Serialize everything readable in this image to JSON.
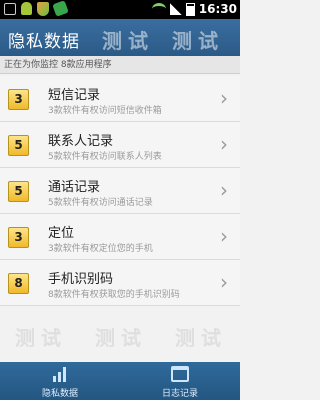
{
  "status_bar": {
    "time": "16:30",
    "icons": [
      "usb-icon",
      "android-icon",
      "shield-icon",
      "phone-icon",
      "wifi-icon",
      "signal-icon",
      "battery-icon"
    ]
  },
  "header": {
    "title": "隐私数据",
    "watermark": "测试"
  },
  "subheader": {
    "text": "正在为你监控 8款应用程序"
  },
  "list": [
    {
      "count": "3",
      "title": "短信记录",
      "subtitle": "3款软件有权访问短信收件箱"
    },
    {
      "count": "5",
      "title": "联系人记录",
      "subtitle": "5款软件有权访问联系人列表"
    },
    {
      "count": "5",
      "title": "通话记录",
      "subtitle": "5款软件有权访问通话记录"
    },
    {
      "count": "3",
      "title": "定位",
      "subtitle": "3款软件有权定位您的手机"
    },
    {
      "count": "8",
      "title": "手机识别码",
      "subtitle": "8款软件有权获取您的手机识别码"
    }
  ],
  "tabs": [
    {
      "label": "隐私数据",
      "icon": "bar-chart-icon"
    },
    {
      "label": "日志记录",
      "icon": "calendar-icon"
    }
  ],
  "colors": {
    "header": "#3a6e9f",
    "tabbar": "#2f6a9b",
    "badge": "#f0b92a"
  }
}
